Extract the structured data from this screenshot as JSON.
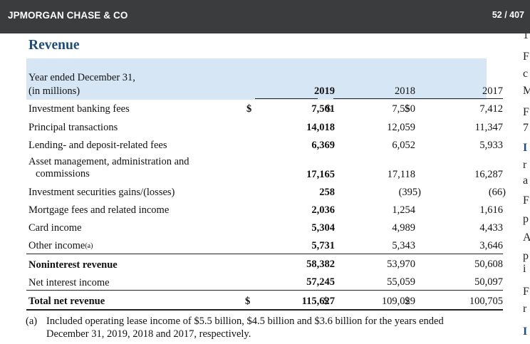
{
  "header": {
    "brand": "JPMORGAN CHASE & CO",
    "pager": "52 / 407"
  },
  "section": {
    "title": "Revenue"
  },
  "table": {
    "header_line1": "Year ended December 31,",
    "header_line2": "(in millions)",
    "years": [
      "2019",
      "2018",
      "2017"
    ],
    "rows": [
      {
        "label": "Investment banking fees",
        "v2019": "7,501",
        "v2018": "7,550",
        "v2017": "7,412",
        "dollar": "$"
      },
      {
        "label": "Principal transactions",
        "v2019": "14,018",
        "v2018": "12,059",
        "v2017": "11,347"
      },
      {
        "label": "Lending- and deposit-related fees",
        "v2019": "6,369",
        "v2018": "6,052",
        "v2017": "5,933"
      },
      {
        "label": "Asset management, administration and",
        "label2": "commissions",
        "v2019": "17,165",
        "v2018": "17,118",
        "v2017": "16,287"
      },
      {
        "label": "Investment securities gains/(losses)",
        "v2019": "258",
        "v2018": "(395)",
        "v2017": "(66)"
      },
      {
        "label": "Mortgage fees and related income",
        "v2019": "2,036",
        "v2018": "1,254",
        "v2017": "1,616"
      },
      {
        "label": "Card income",
        "v2019": "5,304",
        "v2018": "4,989",
        "v2017": "4,433"
      },
      {
        "label": "Other income",
        "label_sup": "(a)",
        "v2019": "5,731",
        "v2018": "5,343",
        "v2017": "3,646"
      },
      {
        "label": "Noninterest revenue",
        "v2019": "58,382",
        "v2018": "53,970",
        "v2017": "50,608"
      },
      {
        "label": "Net interest income",
        "v2019": "57,245",
        "v2018": "55,059",
        "v2017": "50,097"
      },
      {
        "label": "Total net revenue",
        "v2019": "115,627",
        "v2018": "109,029",
        "v2017": "100,705",
        "dollar": "$"
      }
    ],
    "footnote_marker": "(a)",
    "footnote_line1": "Included operating lease income of $5.5 billion, $4.5 billion and $3.6 billion for the years ended",
    "footnote_line2": "December 31, 2019, 2018 and 2017, respectively."
  },
  "right_fragments": [
    "1",
    "F",
    "c",
    "M",
    "F",
    "7",
    "I",
    "r",
    "a",
    "F",
    "p",
    "A",
    "p",
    "i",
    "F",
    "r",
    "I"
  ]
}
